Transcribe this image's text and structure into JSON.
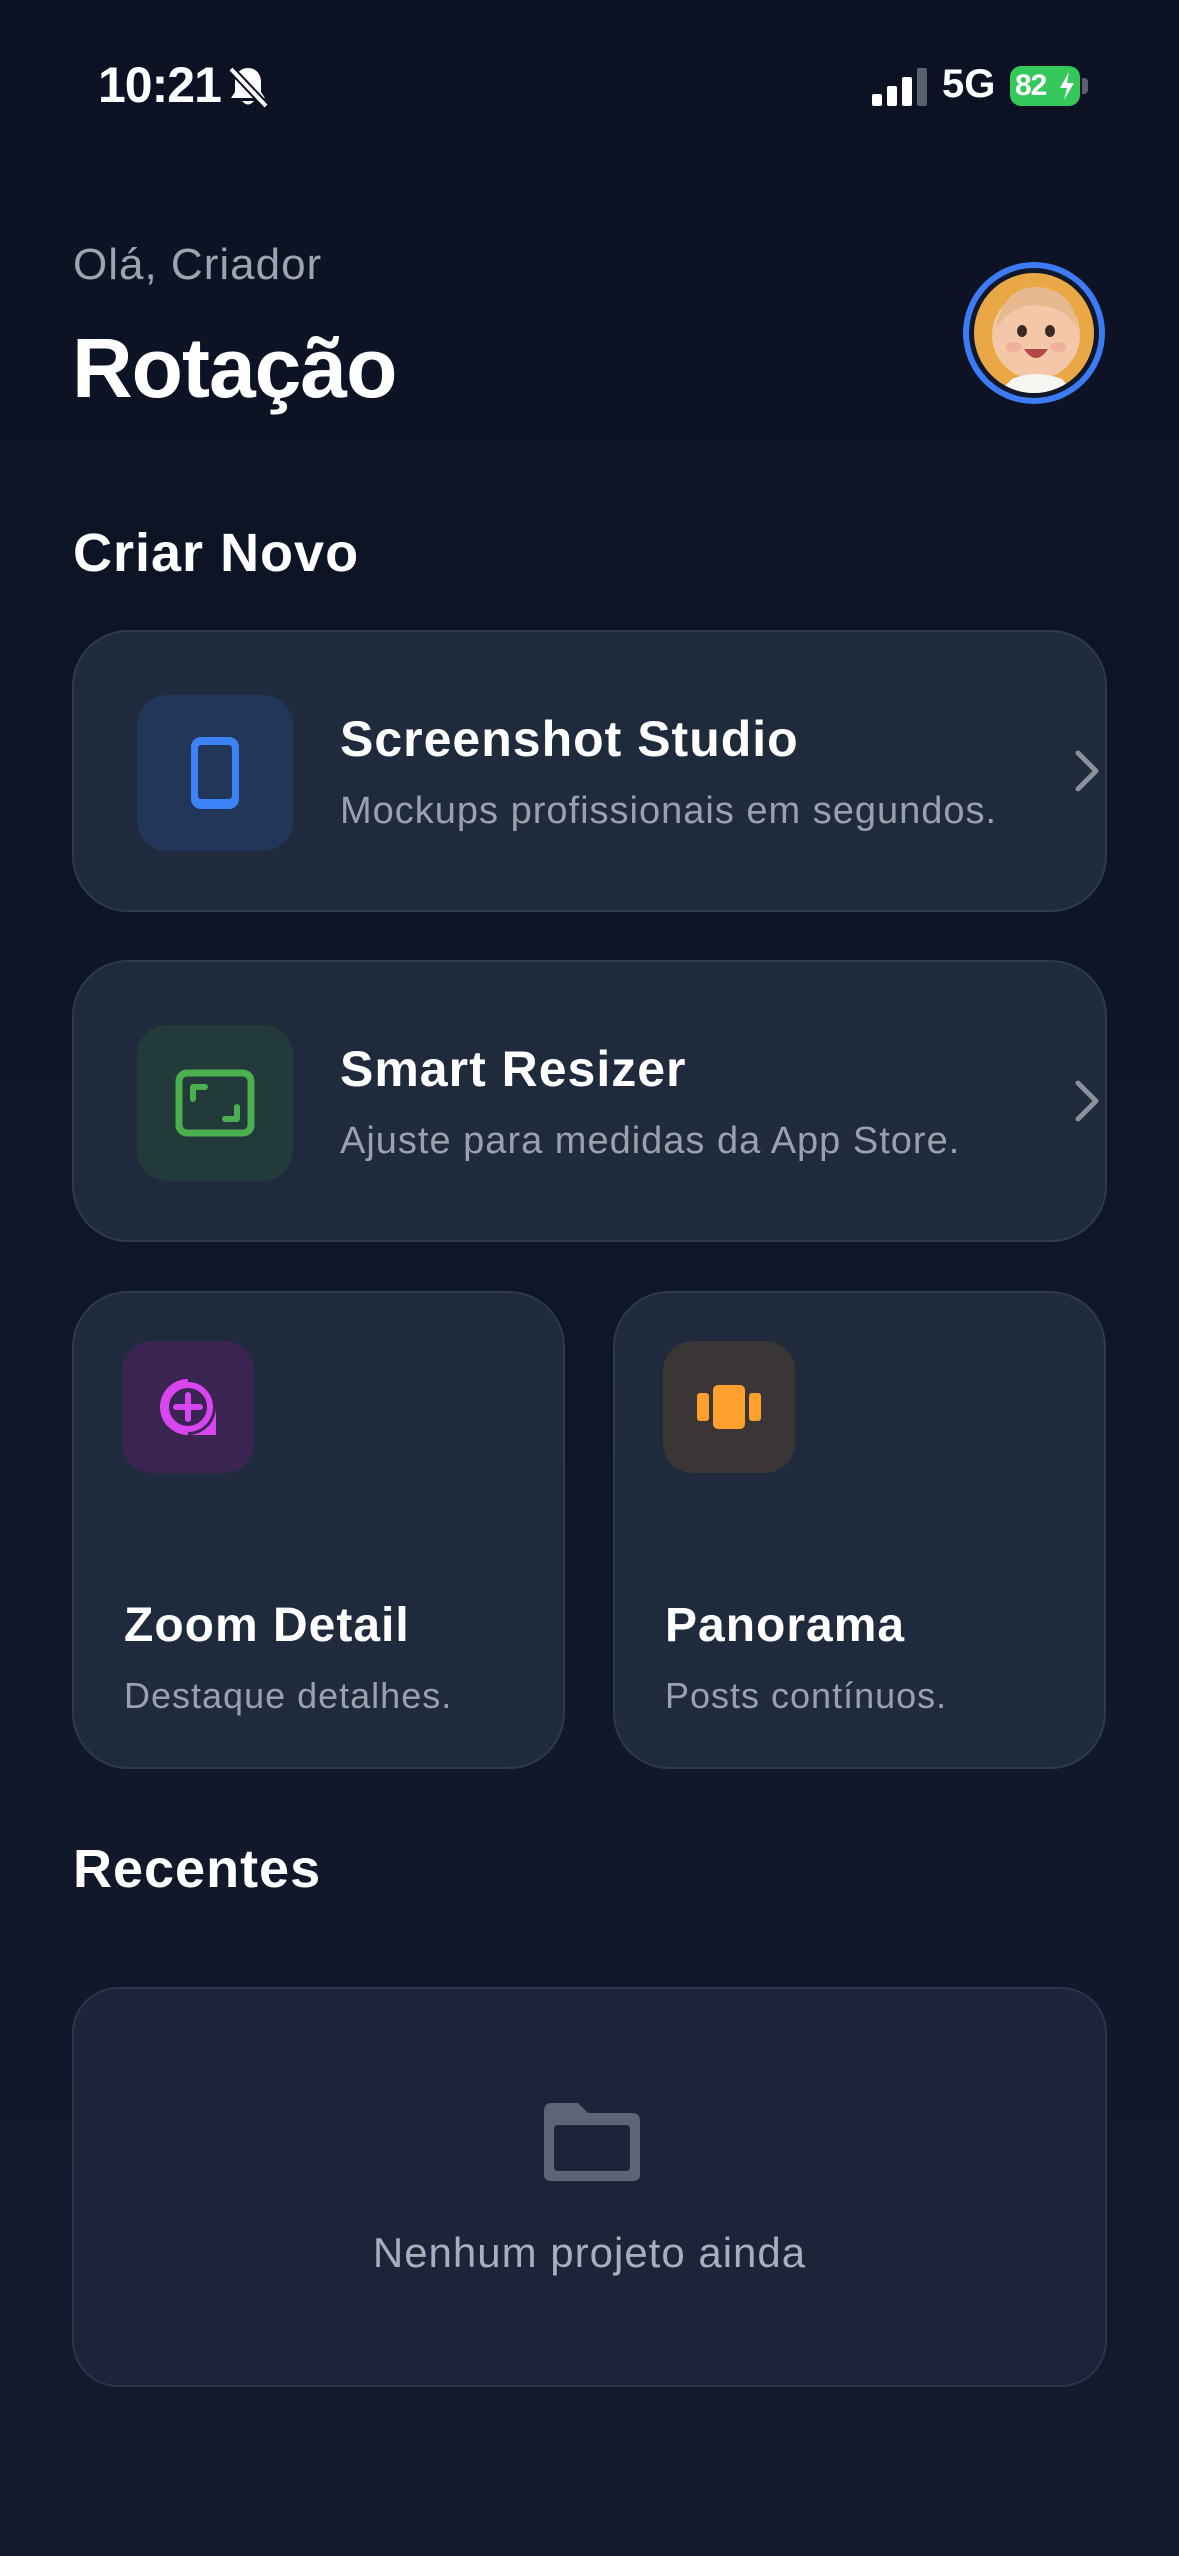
{
  "status_bar": {
    "time": "10:21",
    "network": "5G",
    "battery": "82",
    "battery_color": "#34c759"
  },
  "header": {
    "greeting": "Olá, Criador",
    "title": "Rotação",
    "avatar_ring_color": "#3d7bf5"
  },
  "create_section": {
    "title": "Criar Novo",
    "tools": [
      {
        "title": "Screenshot Studio",
        "subtitle": "Mockups profissionais em segundos.",
        "icon": "phone-icon",
        "accent": "#3d82f7"
      },
      {
        "title": "Smart Resizer",
        "subtitle": "Ajuste para medidas da App Store.",
        "icon": "resize-frame-icon",
        "accent": "#4caf50"
      },
      {
        "title": "Zoom Detail",
        "subtitle": "Destaque detalhes.",
        "icon": "zoom-plus-icon",
        "accent": "#d946ef"
      },
      {
        "title": "Panorama",
        "subtitle": "Posts contínuos.",
        "icon": "panorama-icon",
        "accent": "#ff9f2e"
      }
    ]
  },
  "recents": {
    "title": "Recentes",
    "empty_message": "Nenhum projeto ainda",
    "empty_icon": "folder-icon"
  }
}
